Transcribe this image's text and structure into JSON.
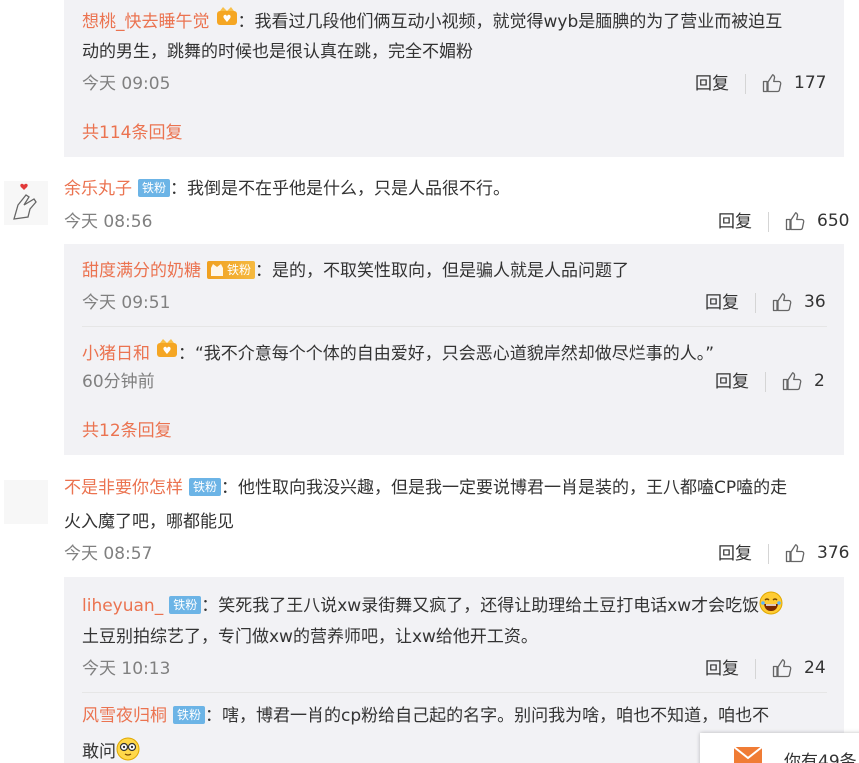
{
  "comments": [
    {
      "replies": [
        {
          "user": "想桃_快去睡午觉",
          "text_line1": "：我看过几段他们俩互动小视频，就觉得wyb是腼腆的为了营业而被迫互",
          "text_line2": "动的男生，跳舞的时候也是很认真在跳，完全不媚粉",
          "time": "今天 09:05",
          "reply_label": "回复",
          "likes": "177"
        }
      ],
      "more_replies": "共114条回复"
    },
    {
      "user": "余乐丸子",
      "badge": "铁粉",
      "text": "：我倒是不在乎他是什么，只是人品很不行。",
      "time": "今天 08:56",
      "reply_label": "回复",
      "likes": "650",
      "replies": [
        {
          "user": "甜度满分的奶糖",
          "badge": "铁粉",
          "text": "：是的，不取笑性取向，但是骗人就是人品问题了",
          "time": "今天 09:51",
          "reply_label": "回复",
          "likes": "36"
        },
        {
          "user": "小猪日和",
          "text": "：“我不介意每个个体的自由爱好，只会恶心道貌岸然却做尽烂事的人。”",
          "time": "60分钟前",
          "reply_label": "回复",
          "likes": "2"
        }
      ],
      "more_replies": "共12条回复"
    },
    {
      "user": "不是非要你怎样",
      "badge": "铁粉",
      "text_line1": "：他性取向我没兴趣，但是我一定要说博君一肖是装的，王八都嗑CP嗑的走",
      "text_line2": "火入魔了吧，哪都能见",
      "time": "今天 08:57",
      "reply_label": "回复",
      "likes": "376",
      "replies": [
        {
          "user": "liheyuan_",
          "badge": "铁粉",
          "text_line1": "：笑死我了王八说xw录街舞又疯了，还得让助理给土豆打电话xw才会吃饭",
          "text_line2": "土豆别拍综艺了，专门做xw的营养师吧，让xw给他开工资。",
          "time": "今天 10:13",
          "reply_label": "回复",
          "likes": "24"
        },
        {
          "user": "风雪夜归桐",
          "badge": "铁粉",
          "text_line1": "：嗐，博君一肖的cp粉给自己起的名字。别问我为啥，咱也不知道，咱也不",
          "text_line2": "敢问"
        }
      ]
    }
  ],
  "mail_notice": "你有49条",
  "icons": {
    "like": "thumb-up-icon",
    "mail": "mail-icon",
    "gold_badge": "gold-member-icon",
    "emoji_laugh": "laugh-emoji-icon",
    "emoji_glasses": "glasses-emoji-icon"
  },
  "colors": {
    "username": "#eb7350",
    "badge_fan": "#6cb4e6",
    "reply_bg": "#f2f2f5",
    "meta": "#808080"
  }
}
